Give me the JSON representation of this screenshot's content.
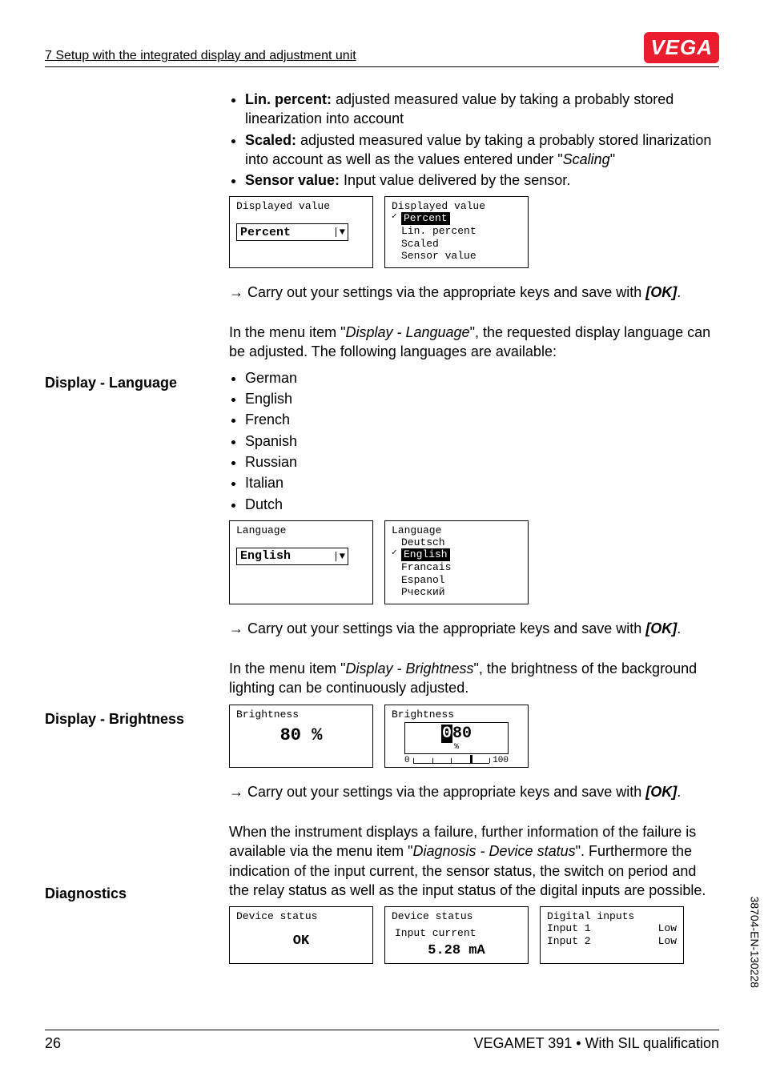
{
  "header": {
    "section_title": "7 Setup with the integrated display and adjustment unit",
    "logo_text": "VEGA"
  },
  "intro_bullets": [
    {
      "label": "Lin. percent:",
      "text": " adjusted measured value by taking a probably stored linearization into account"
    },
    {
      "label": "Scaled:",
      "text": " adjusted measured value by taking a probably stored linarization into account as well as the values entered under \"",
      "italic": "Scaling",
      "tail": "\""
    },
    {
      "label": "Sensor value:",
      "text": " Input value delivered by the sensor."
    }
  ],
  "displayed_value": {
    "left_title": "Displayed value",
    "left_selection": "Percent",
    "right_title": "Displayed value",
    "right_options": [
      "Percent",
      "Lin. percent",
      "Scaled",
      "Sensor value"
    ],
    "right_selected_index": 0
  },
  "action_ok": "Carry out your settings via the appropriate keys and save with ",
  "ok_label": "[OK]",
  "period": ".",
  "language_section": {
    "label": "Display - Language",
    "intro_pre": "In the menu item \"",
    "intro_italic": "Display - Language",
    "intro_post": "\", the requested display language can be adjusted. The following languages are available:",
    "bullets": [
      "German",
      "English",
      "French",
      "Spanish",
      "Russian",
      "Italian",
      "Dutch"
    ],
    "left_title": "Language",
    "left_selection": "English",
    "right_title": "Language",
    "right_options": [
      "Deutsch",
      "English",
      "Francais",
      "Espanol",
      "Рческий"
    ],
    "right_selected_index": 1
  },
  "brightness_section": {
    "label": "Display - Brightness",
    "intro_pre": "In the menu item \"",
    "intro_italic": "Display - Brightness",
    "intro_post": "\", the brightness of the background lighting can be continuously adjusted.",
    "left_title": "Brightness",
    "left_value": "80 %",
    "right_title": "Brightness",
    "right_digits": "080",
    "right_unit": "%",
    "scale_min": "0",
    "scale_max": "100"
  },
  "diagnostics_section": {
    "label": "Diagnostics",
    "text_pre": "When the instrument displays a failure, further information of the failure is available via the menu item \"",
    "text_italic": "Diagnosis - Device status",
    "text_post": "\". Furthermore the indication of the input current, the sensor status, the switch on period and the relay status as well as the input status of the digital inputs are possible.",
    "screen1_title": "Device status",
    "screen1_value": "OK",
    "screen2_title": "Device status",
    "screen2_sub": "Input current",
    "screen2_value": "5.28 mA",
    "screen3_title": "Digital inputs",
    "screen3_rows": [
      {
        "name": "Input 1",
        "val": "Low"
      },
      {
        "name": "Input 2",
        "val": "Low"
      }
    ]
  },
  "footer": {
    "page": "26",
    "product": "VEGAMET 391 • With SIL qualification",
    "doc_code": "38704-EN-130228"
  }
}
